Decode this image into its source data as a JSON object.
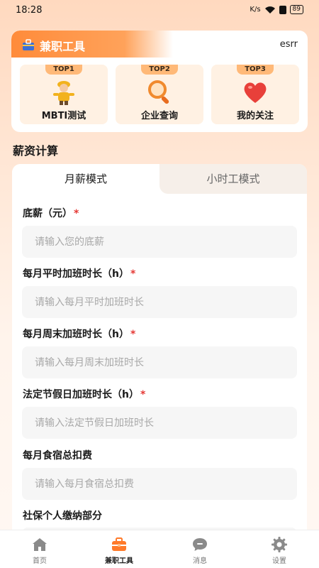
{
  "status_bar": {
    "time": "18:28",
    "battery": "89",
    "net_speed": "K/s"
  },
  "tools": {
    "title": "兼职工具",
    "user": "esrr",
    "items": [
      {
        "badge": "TOP1",
        "label": "MBTI测试",
        "icon": "worker-figure-icon"
      },
      {
        "badge": "TOP2",
        "label": "企业查询",
        "icon": "magnifier-icon"
      },
      {
        "badge": "TOP3",
        "label": "我的关注",
        "icon": "heart-icon"
      }
    ]
  },
  "salary": {
    "section_title": "薪资计算",
    "tabs": {
      "monthly": "月薪模式",
      "hourly": "小时工模式",
      "active": "monthly"
    },
    "fields": [
      {
        "label": "底薪（元）",
        "required": "*",
        "placeholder": "请输入您的底薪"
      },
      {
        "label": "每月平时加班时长（h）",
        "required": "*",
        "placeholder": "请输入每月平时加班时长"
      },
      {
        "label": "每月周末加班时长（h）",
        "required": "*",
        "placeholder": "请输入每月周末加班时长"
      },
      {
        "label": "法定节假日加班时长（h）",
        "required": "*",
        "placeholder": "请输入法定节假日加班时长"
      },
      {
        "label": "每月食宿总扣费",
        "required": "",
        "placeholder": "请输入每月食宿总扣费"
      },
      {
        "label": "社保个人缴纳部分",
        "required": "",
        "placeholder": ""
      }
    ]
  },
  "nav": {
    "items": [
      {
        "label": "首页",
        "icon": "home-icon"
      },
      {
        "label": "兼职工具",
        "icon": "briefcase-icon",
        "active": true
      },
      {
        "label": "消息",
        "icon": "message-icon"
      },
      {
        "label": "设置",
        "icon": "gear-icon"
      }
    ]
  },
  "colors": {
    "accent": "#ff8b3a",
    "required": "#e53935",
    "tile": "#fff1e3"
  }
}
